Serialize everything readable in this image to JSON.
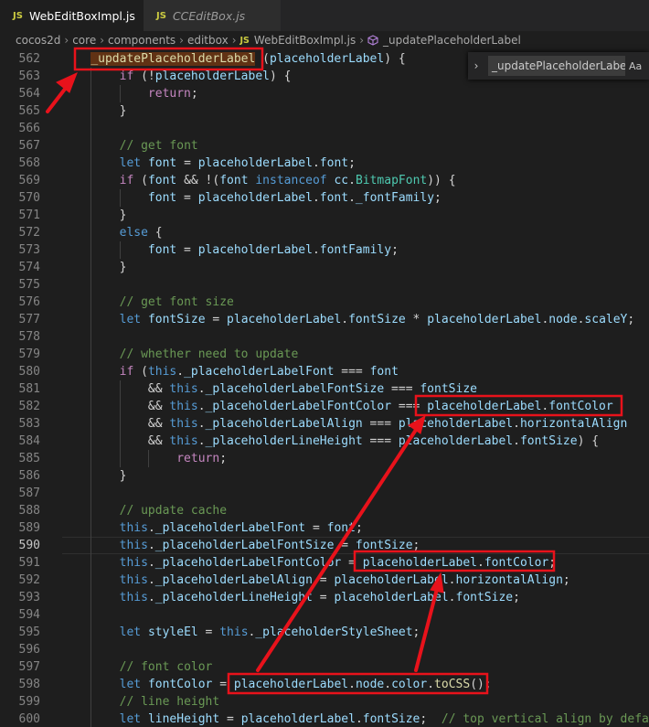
{
  "tabs": [
    {
      "icon": "JS",
      "label": "WebEditBoxImpl.js",
      "active": true
    },
    {
      "icon": "JS",
      "label": "CCEditBox.js",
      "active": false
    }
  ],
  "breadcrumb": {
    "parts": [
      "cocos2d",
      "core",
      "components",
      "editbox"
    ],
    "file_icon": "JS",
    "file": "WebEditBoxImpl.js",
    "symbol_icon": "cube-icon",
    "symbol": "_updatePlaceholderLabel"
  },
  "find_widget": {
    "value": "_updatePlaceholderLabel",
    "match_case_label": "Aa"
  },
  "current_line": 590,
  "lines": [
    {
      "n": 562,
      "t": "    _updatePlaceholderLabel (placeholderLabel) {"
    },
    {
      "n": 563,
      "t": "        if (!placeholderLabel) {"
    },
    {
      "n": 564,
      "t": "            return;"
    },
    {
      "n": 565,
      "t": "        }"
    },
    {
      "n": 566,
      "t": ""
    },
    {
      "n": 567,
      "t": "        // get font"
    },
    {
      "n": 568,
      "t": "        let font = placeholderLabel.font;"
    },
    {
      "n": 569,
      "t": "        if (font && !(font instanceof cc.BitmapFont)) {"
    },
    {
      "n": 570,
      "t": "            font = placeholderLabel.font._fontFamily;"
    },
    {
      "n": 571,
      "t": "        }"
    },
    {
      "n": 572,
      "t": "        else {"
    },
    {
      "n": 573,
      "t": "            font = placeholderLabel.fontFamily;"
    },
    {
      "n": 574,
      "t": "        }"
    },
    {
      "n": 575,
      "t": ""
    },
    {
      "n": 576,
      "t": "        // get font size"
    },
    {
      "n": 577,
      "t": "        let fontSize = placeholderLabel.fontSize * placeholderLabel.node.scaleY;"
    },
    {
      "n": 578,
      "t": ""
    },
    {
      "n": 579,
      "t": "        // whether need to update"
    },
    {
      "n": 580,
      "t": "        if (this._placeholderLabelFont === font"
    },
    {
      "n": 581,
      "t": "            && this._placeholderLabelFontSize === fontSize"
    },
    {
      "n": 582,
      "t": "            && this._placeholderLabelFontColor === placeholderLabel.fontColor"
    },
    {
      "n": 583,
      "t": "            && this._placeholderLabelAlign === placeholderLabel.horizontalAlign"
    },
    {
      "n": 584,
      "t": "            && this._placeholderLineHeight === placeholderLabel.fontSize) {"
    },
    {
      "n": 585,
      "t": "                return;"
    },
    {
      "n": 586,
      "t": "        }"
    },
    {
      "n": 587,
      "t": ""
    },
    {
      "n": 588,
      "t": "        // update cache"
    },
    {
      "n": 589,
      "t": "        this._placeholderLabelFont = font;"
    },
    {
      "n": 590,
      "t": "        this._placeholderLabelFontSize = fontSize;"
    },
    {
      "n": 591,
      "t": "        this._placeholderLabelFontColor = placeholderLabel.fontColor;"
    },
    {
      "n": 592,
      "t": "        this._placeholderLabelAlign = placeholderLabel.horizontalAlign;"
    },
    {
      "n": 593,
      "t": "        this._placeholderLineHeight = placeholderLabel.fontSize;"
    },
    {
      "n": 594,
      "t": ""
    },
    {
      "n": 595,
      "t": "        let styleEl = this._placeholderStyleSheet;"
    },
    {
      "n": 596,
      "t": ""
    },
    {
      "n": 597,
      "t": "        // font color"
    },
    {
      "n": 598,
      "t": "        let fontColor = placeholderLabel.node.color.toCSS();"
    },
    {
      "n": 599,
      "t": "        // line height"
    },
    {
      "n": 600,
      "t": "        let lineHeight = placeholderLabel.fontSize;  // top vertical align by default"
    }
  ],
  "colors": {
    "background": "#1e1e1e",
    "keyword": "#569cd6",
    "control": "#c586c0",
    "function": "#dcdcaa",
    "comment": "#6a9955",
    "type": "#4ec9b0",
    "variable": "#9cdcfe",
    "annotation": "#e8121b"
  }
}
